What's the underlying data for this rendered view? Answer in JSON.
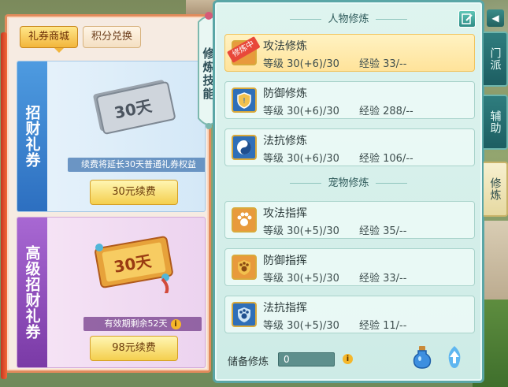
{
  "shop": {
    "tabs": [
      {
        "label": "礼券商城",
        "active": true
      },
      {
        "label": "积分兑换",
        "active": false
      }
    ],
    "cards": [
      {
        "title": "招财礼券",
        "ticket_text": "30天",
        "description": "续费将延长30天普通礼券权益",
        "button": "30元续费"
      },
      {
        "title": "高级招财礼券",
        "ticket_text": "30天",
        "description": "有效期剩余52天",
        "info_icon": "info-icon",
        "button": "98元续费"
      }
    ]
  },
  "banner": {
    "label": "修炼技能"
  },
  "skills": {
    "sections": [
      {
        "title": "人物修炼",
        "items": [
          {
            "name": "攻法修炼",
            "level": "等级 30(+6)/30",
            "exp": "经验 33/--",
            "badge": "修炼中",
            "icon": "attack-magic-icon",
            "selected": true
          },
          {
            "name": "防御修炼",
            "level": "等级 30(+6)/30",
            "exp": "经验 288/--",
            "icon": "defense-shield-icon"
          },
          {
            "name": "法抗修炼",
            "level": "等级 30(+6)/30",
            "exp": "经验 106/--",
            "icon": "magic-resist-yinyang-icon"
          }
        ]
      },
      {
        "title": "宠物修炼",
        "items": [
          {
            "name": "攻法指挥",
            "level": "等级 30(+5)/30",
            "exp": "经验 35/--",
            "icon": "paw-attack-icon"
          },
          {
            "name": "防御指挥",
            "level": "等级 30(+5)/30",
            "exp": "经验 33/--",
            "icon": "paw-defense-icon"
          },
          {
            "name": "法抗指挥",
            "level": "等级 30(+5)/30",
            "exp": "经验 11/--",
            "icon": "paw-resist-icon"
          }
        ]
      }
    ],
    "footer": {
      "label": "储备修炼",
      "value": "0",
      "potion_icon": "potion-icon",
      "upgrade_icon": "upgrade-arrow-icon"
    }
  },
  "side_tabs": [
    {
      "label": "门派",
      "active": false
    },
    {
      "label": "辅助",
      "active": false
    },
    {
      "label": "修炼",
      "active": true
    }
  ],
  "colors": {
    "shop_border": "#e28b5c",
    "skills_border": "#5aa6a6",
    "selected_row": "#ffe39a",
    "badge_red": "#e8483a"
  }
}
